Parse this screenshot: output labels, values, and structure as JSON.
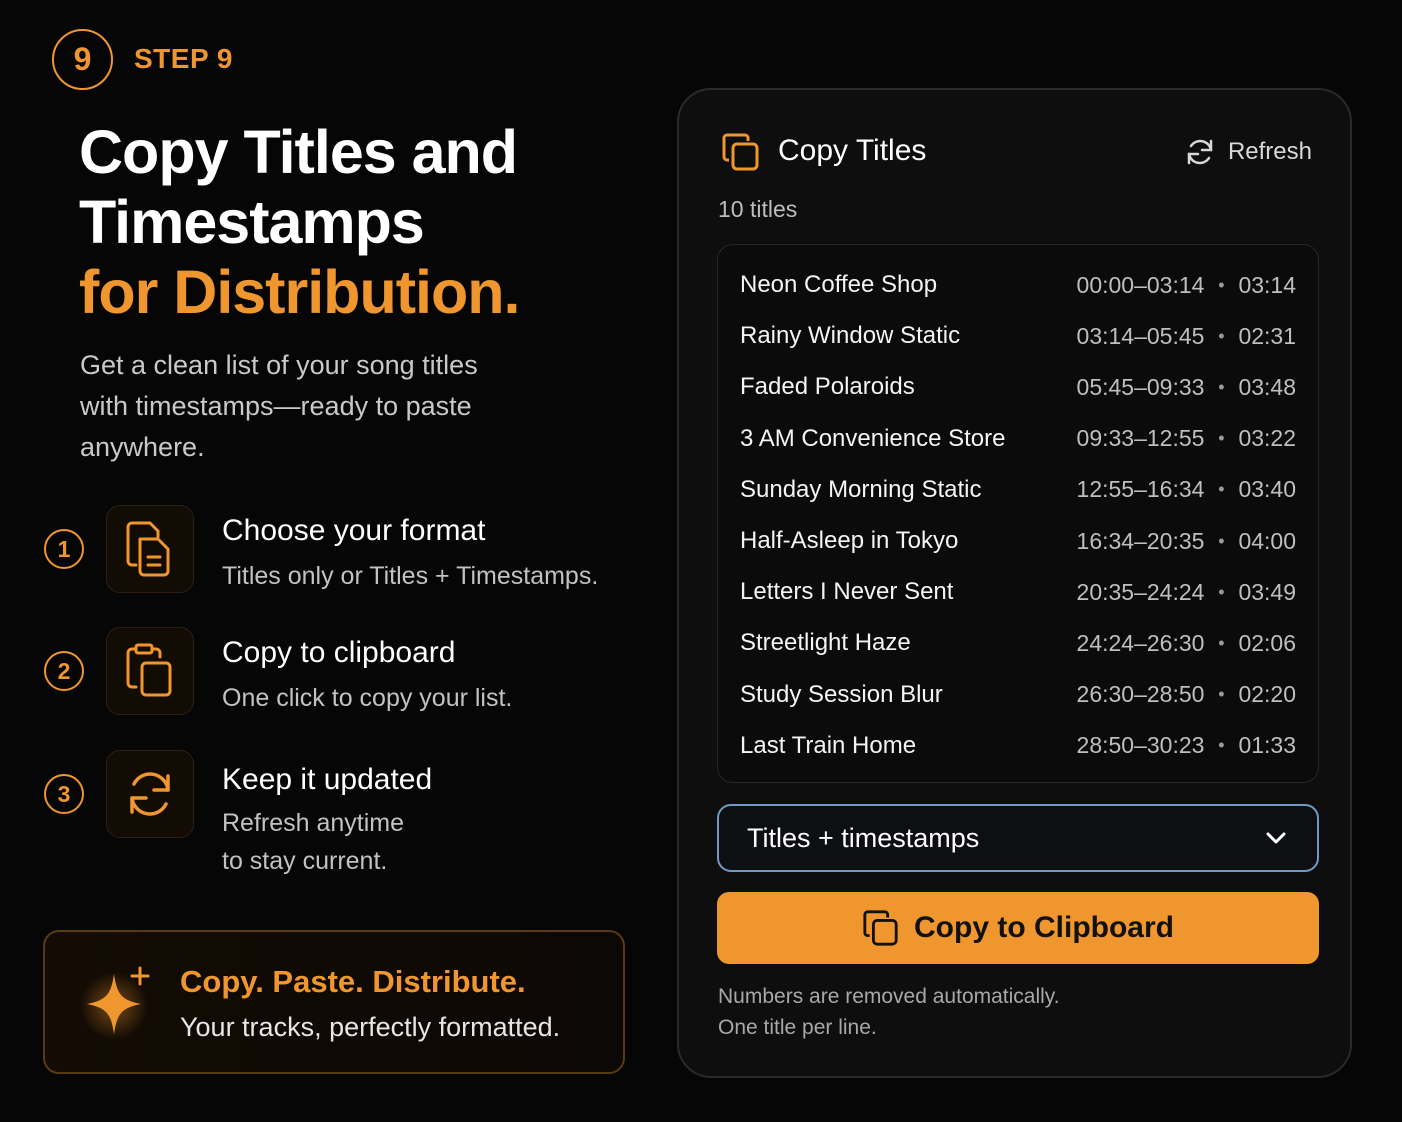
{
  "step": {
    "number": "9",
    "label": "STEP 9"
  },
  "hero": {
    "line1": "Copy Titles and",
    "line2": "Timestamps",
    "line3": "for Distribution."
  },
  "subtitle": "Get a clean list of your song titles with timestamps—ready to paste anywhere.",
  "features": [
    {
      "num": "1",
      "icon": "document-copy-icon",
      "title": "Choose your format",
      "desc": "Titles only or Titles + Timestamps."
    },
    {
      "num": "2",
      "icon": "clipboard-icon",
      "title": "Copy to clipboard",
      "desc": "One click to copy your list."
    },
    {
      "num": "3",
      "icon": "refresh-icon",
      "title": "Keep it updated",
      "desc1": "Refresh anytime",
      "desc2": "to stay current."
    }
  ],
  "promo": {
    "title": "Copy. Paste. Distribute.",
    "desc": "Your tracks, perfectly formatted.",
    "icon": "sparkle-icon"
  },
  "panel": {
    "title": "Copy Titles",
    "refresh_label": "Refresh",
    "count": "10 titles",
    "tracks": [
      {
        "title": "Neon Coffee Shop",
        "range": "00:00–03:14",
        "duration": "03:14"
      },
      {
        "title": "Rainy Window Static",
        "range": "03:14–05:45",
        "duration": "02:31"
      },
      {
        "title": "Faded Polaroids",
        "range": "05:45–09:33",
        "duration": "03:48"
      },
      {
        "title": "3 AM Convenience Store",
        "range": "09:33–12:55",
        "duration": "03:22"
      },
      {
        "title": "Sunday Morning Static",
        "range": "12:55–16:34",
        "duration": "03:40"
      },
      {
        "title": "Half-Asleep in Tokyo",
        "range": "16:34–20:35",
        "duration": "04:00"
      },
      {
        "title": "Letters I Never Sent",
        "range": "20:35–24:24",
        "duration": "03:49"
      },
      {
        "title": "Streetlight Haze",
        "range": "24:24–26:30",
        "duration": "02:06"
      },
      {
        "title": "Study Session Blur",
        "range": "26:30–28:50",
        "duration": "02:20"
      },
      {
        "title": "Last Train Home",
        "range": "28:50–30:23",
        "duration": "01:33"
      }
    ],
    "separator": "•",
    "format_select": {
      "value": "Titles + timestamps"
    },
    "copy_button_label": "Copy to Clipboard",
    "notes": [
      "Numbers are removed automatically.",
      "One title per line."
    ]
  },
  "colors": {
    "accent": "#f0962e",
    "background": "#060606",
    "panel": "#0e0e0e",
    "select_border": "#6f9ac4"
  }
}
